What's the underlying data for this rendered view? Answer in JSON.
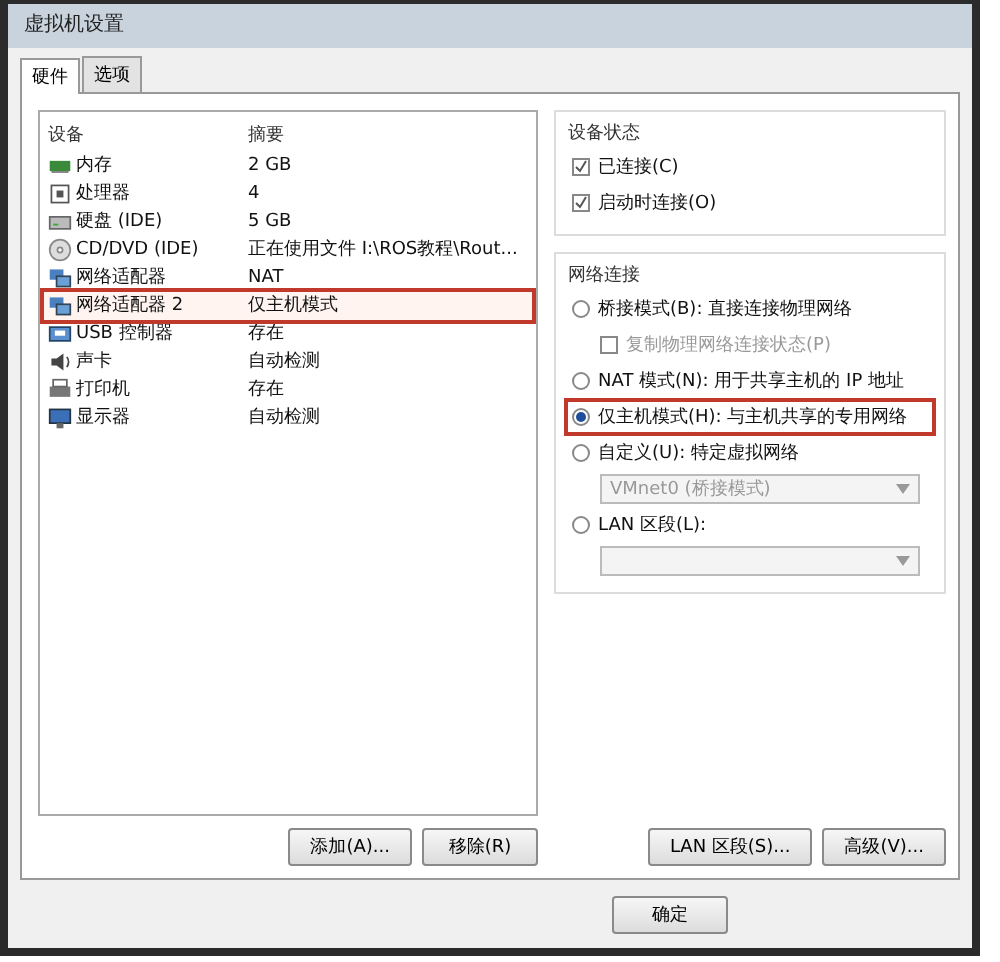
{
  "window": {
    "title": "虚拟机设置"
  },
  "tabs": [
    {
      "label": "硬件",
      "selected": true
    },
    {
      "label": "选项",
      "selected": false
    }
  ],
  "device_table": {
    "columns": [
      "设备",
      "摘要"
    ],
    "rows": [
      {
        "device": "内存",
        "summary": "2 GB",
        "highlighted": false
      },
      {
        "device": "处理器",
        "summary": "4",
        "highlighted": false
      },
      {
        "device": "硬盘 (IDE)",
        "summary": "5 GB",
        "highlighted": false
      },
      {
        "device": "CD/DVD (IDE)",
        "summary": "正在使用文件 I:\\ROS教程\\Rout...",
        "highlighted": false
      },
      {
        "device": "网络适配器",
        "summary": "NAT",
        "highlighted": false
      },
      {
        "device": "网络适配器 2",
        "summary": "仅主机模式",
        "highlighted": true
      },
      {
        "device": "USB 控制器",
        "summary": "存在",
        "highlighted": false
      },
      {
        "device": "声卡",
        "summary": "自动检测",
        "highlighted": false
      },
      {
        "device": "打印机",
        "summary": "存在",
        "highlighted": false
      },
      {
        "device": "显示器",
        "summary": "自动检测",
        "highlighted": false
      }
    ]
  },
  "list_buttons": [
    "添加(A)...",
    "移除(R)"
  ],
  "device_status": {
    "title": "设备状态",
    "options": [
      {
        "label": "已连接(C)",
        "checked": true
      },
      {
        "label": "启动时连接(O)",
        "checked": true
      }
    ]
  },
  "network_connection": {
    "title": "网络连接",
    "items": [
      {
        "kind": "radio",
        "label": "桥接模式(B): 直接连接物理网络",
        "selected": false,
        "highlighted": false
      },
      {
        "kind": "checkbox",
        "label": "复制物理网络连接状态(P)",
        "checked": false,
        "disabled": true
      },
      {
        "kind": "radio",
        "label": "NAT 模式(N): 用于共享主机的 IP 地址",
        "selected": false,
        "highlighted": false
      },
      {
        "kind": "radio",
        "label": "仅主机模式(H): 与主机共享的专用网络",
        "selected": true,
        "highlighted": true
      },
      {
        "kind": "radio",
        "label": "自定义(U): 特定虚拟网络",
        "selected": false,
        "highlighted": false
      },
      {
        "kind": "dropdown",
        "value": "VMnet0 (桥接模式)",
        "disabled": true
      },
      {
        "kind": "radio",
        "label": "LAN 区段(L):",
        "selected": false,
        "highlighted": false
      },
      {
        "kind": "dropdown",
        "disabled": true
      }
    ]
  },
  "panel_buttons": [
    "LAN 区段(S)...",
    "高级(V)..."
  ],
  "dialog_buttons": [
    "确定"
  ]
}
